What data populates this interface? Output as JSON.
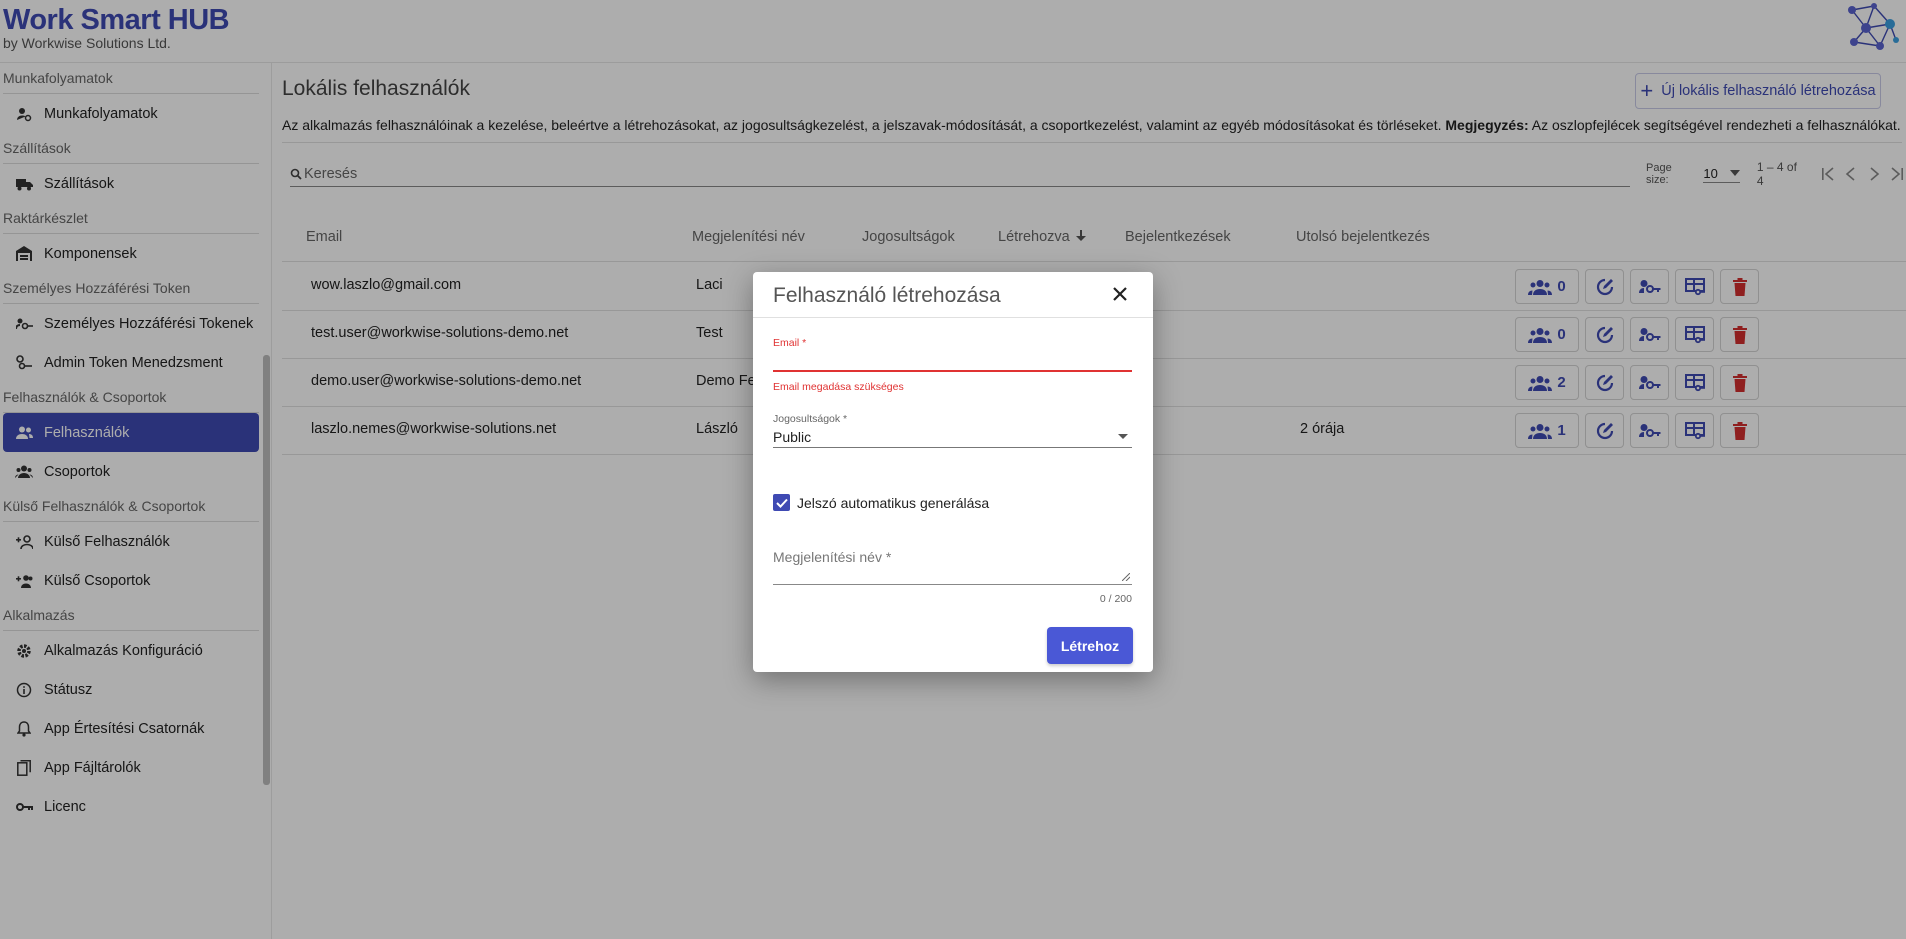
{
  "brand": {
    "title": "Work Smart HUB",
    "subtitle": "by Workwise Solutions Ltd."
  },
  "sidebar": {
    "sections": [
      {
        "title": "Munkafolyamatok",
        "items": [
          {
            "label": "Munkafolyamatok",
            "icon": "workflow-user-gear-icon"
          }
        ]
      },
      {
        "title": "Szállítások",
        "items": [
          {
            "label": "Szállítások",
            "icon": "truck-icon"
          }
        ]
      },
      {
        "title": "Raktárkészlet",
        "items": [
          {
            "label": "Komponensek",
            "icon": "warehouse-icon"
          }
        ]
      },
      {
        "title": "Személyes Hozzáférési Token",
        "items": [
          {
            "label": "Személyes Hozzáférési Tokenek",
            "icon": "user-key-icon"
          },
          {
            "label": "Admin Token Menedzsment",
            "icon": "admin-key-icon"
          }
        ]
      },
      {
        "title": "Felhasználók & Csoportok",
        "items": [
          {
            "label": "Felhasználók",
            "icon": "users-icon",
            "active": true
          },
          {
            "label": "Csoportok",
            "icon": "groups-icon"
          }
        ]
      },
      {
        "title": "Külső Felhasználók & Csoportok",
        "items": [
          {
            "label": "Külső Felhasználók",
            "icon": "add-user-icon"
          },
          {
            "label": "Külső Csoportok",
            "icon": "add-group-icon"
          }
        ]
      },
      {
        "title": "Alkalmazás",
        "items": [
          {
            "label": "Alkalmazás Konfiguráció",
            "icon": "gear-icon"
          },
          {
            "label": "Státusz",
            "icon": "info-icon"
          },
          {
            "label": "App Értesítési Csatornák",
            "icon": "bell-icon"
          },
          {
            "label": "App Fájltárolók",
            "icon": "file-icon"
          },
          {
            "label": "Licenc",
            "icon": "key-icon"
          }
        ]
      }
    ]
  },
  "main": {
    "title": "Lokális felhasználók",
    "new_button": "Új lokális felhasználó létrehozása",
    "description": "Az alkalmazás felhasználóinak a kezelése, beleértve a létrehozásokat, az jogosultságkezelést, a jelszavak-módosítását, a csoportkezelést, valamint az egyéb módosításokat és törléseket.",
    "note_label": "Megjegyzés:",
    "note_text": "Az oszlopfejlécek segítségével rendezheti a felhasználókat.",
    "search_placeholder": "Keresés",
    "pager": {
      "page_size_label": "Page size:",
      "page_size": "10",
      "range": "1 – 4 of 4"
    },
    "columns": {
      "email": "Email",
      "display_name": "Megjelenítési név",
      "roles": "Jogosultságok",
      "created": "Létrehozva",
      "logins": "Bejelentkezések",
      "last_login": "Utolsó bejelentkezés"
    },
    "rows": [
      {
        "email": "wow.laszlo@gmail.com",
        "name": "Laci",
        "last_login": "",
        "groups": "0"
      },
      {
        "email": "test.user@workwise-solutions-demo.net",
        "name": "Test",
        "last_login": "",
        "groups": "0"
      },
      {
        "email": "demo.user@workwise-solutions-demo.net",
        "name": "Demo Fe",
        "last_login": "",
        "groups": "2"
      },
      {
        "email": "laszlo.nemes@workwise-solutions.net",
        "name": "László",
        "last_login": "2 órája",
        "groups": "1"
      }
    ]
  },
  "dialog": {
    "title": "Felhasználó létrehozása",
    "email_label": "Email *",
    "email_value": "",
    "email_error": "Email megadása szükséges",
    "role_label": "Jogosultságok *",
    "role_value": "Public",
    "auto_password_label": "Jelszó automatikus generálása",
    "auto_password_checked": true,
    "display_name_placeholder": "Megjelenítési név *",
    "char_count": "0 / 200",
    "submit_label": "Létrehoz"
  },
  "colors": {
    "brand": "#3f4ab3",
    "primary_button": "#4a58d6",
    "error": "#e03232",
    "delete": "#d32f2f"
  }
}
